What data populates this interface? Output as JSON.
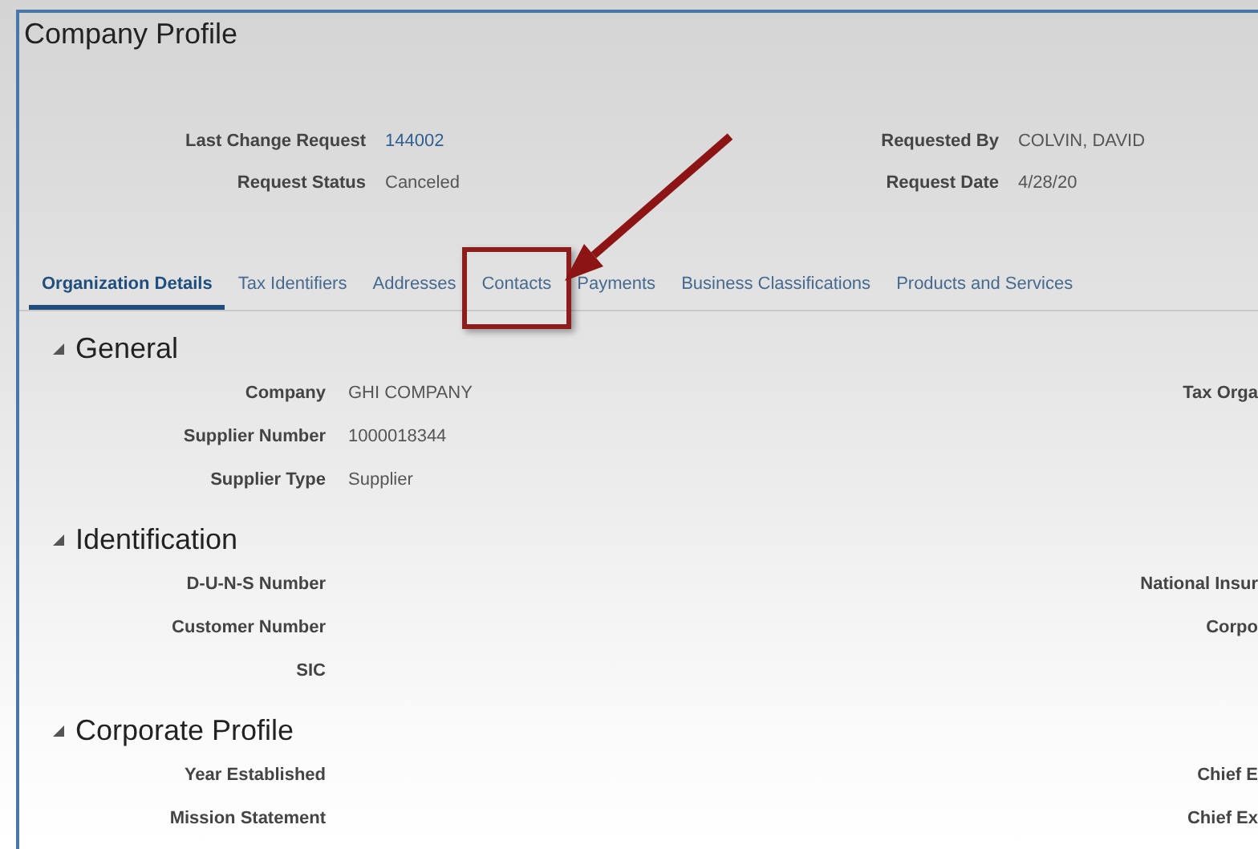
{
  "window": {
    "title": "Company Profile"
  },
  "header": {
    "left": [
      {
        "label": "Last Change Request",
        "value": "144002",
        "kind": "link"
      },
      {
        "label": "Request Status",
        "value": "Canceled",
        "kind": "text"
      }
    ],
    "right": [
      {
        "label": "Requested By",
        "value": "COLVIN, DAVID"
      },
      {
        "label": "Request Date",
        "value": "4/28/20"
      }
    ]
  },
  "tabs": [
    {
      "label": "Organization Details",
      "selected": true,
      "highlighted": false
    },
    {
      "label": "Tax Identifiers",
      "selected": false,
      "highlighted": false
    },
    {
      "label": "Addresses",
      "selected": false,
      "highlighted": false
    },
    {
      "label": "Contacts",
      "selected": false,
      "highlighted": true
    },
    {
      "label": "Payments",
      "selected": false,
      "highlighted": false
    },
    {
      "label": "Business Classifications",
      "selected": false,
      "highlighted": false
    },
    {
      "label": "Products and Services",
      "selected": false,
      "highlighted": false
    }
  ],
  "sections": [
    {
      "title": "General",
      "expanded": true,
      "fields": [
        {
          "label": "Company",
          "value": "GHI COMPANY",
          "right_label": "Tax Orga"
        },
        {
          "label": "Supplier Number",
          "value": "1000018344"
        },
        {
          "label": "Supplier Type",
          "value": "Supplier"
        }
      ]
    },
    {
      "title": "Identification",
      "expanded": true,
      "fields": [
        {
          "label": "D-U-N-S Number",
          "right_label": "National Insur"
        },
        {
          "label": "Customer Number",
          "right_label": "Corpo"
        },
        {
          "label": "SIC"
        }
      ]
    },
    {
      "title": "Corporate Profile",
      "expanded": true,
      "fields": [
        {
          "label": "Year Established",
          "right_label": "Chief E"
        },
        {
          "label": "Mission Statement",
          "right_label": "Chief Ex"
        }
      ]
    }
  ]
}
